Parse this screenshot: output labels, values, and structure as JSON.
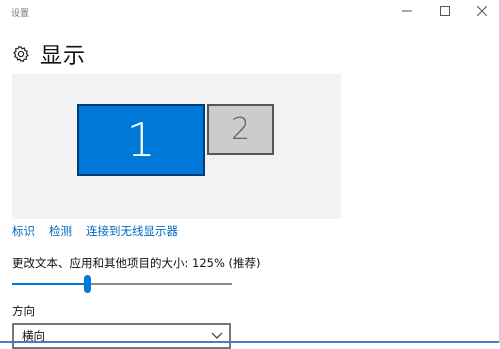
{
  "window": {
    "title": "设置",
    "controls": {
      "minimize": "—",
      "maximize": "☐",
      "close": "✕"
    }
  },
  "header": {
    "icon": "gear-icon",
    "title": "显示"
  },
  "display_arrangement": {
    "monitors": [
      {
        "label": "1",
        "selected": true
      },
      {
        "label": "2",
        "selected": false
      }
    ],
    "colors": {
      "selected": "#0078d7",
      "unselected": "#cccccc",
      "background": "#f2f2f2"
    }
  },
  "links": {
    "identify": "标识",
    "detect": "检测",
    "connect_wireless": "连接到无线显示器"
  },
  "scale": {
    "label": "更改文本、应用和其他项目的大小: 125% (推荐)",
    "slider_level": 0.34
  },
  "orientation": {
    "label": "方向",
    "selected": "横向"
  }
}
